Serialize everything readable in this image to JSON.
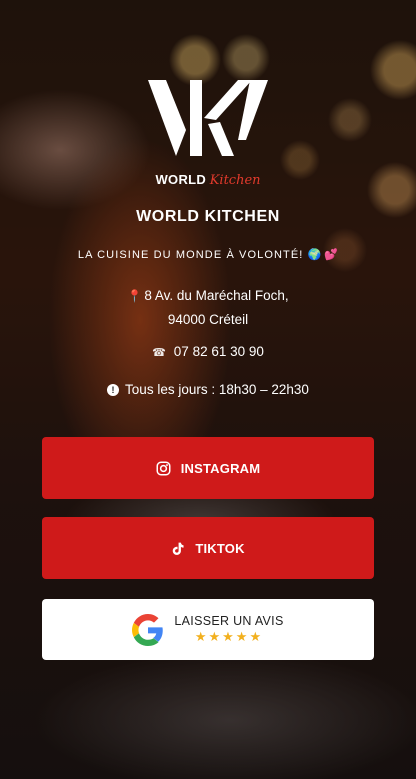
{
  "logo": {
    "brand_word": "WORLD",
    "script_word": "Kitchen"
  },
  "brand_name": "WORLD KITCHEN",
  "tagline": {
    "text": "LA CUISINE DU MONDE À VOLONTÉ!",
    "emojis": "🌍 💕"
  },
  "address": {
    "line1": "8 Av. du Maréchal Foch,",
    "line2": "94000 Créteil"
  },
  "phone": "07 82 61 30 90",
  "hours": "Tous les jours : 18h30 – 22h30",
  "buttons": {
    "instagram": "INSTAGRAM",
    "tiktok": "TIKTOK",
    "review": {
      "label": "LAISSER UN AVIS",
      "stars": "★★★★★",
      "rating": 5
    }
  },
  "colors": {
    "accent": "#cf1a1a",
    "star": "#f2b01e",
    "script": "#e23a2c"
  },
  "icons": [
    "pin-icon",
    "phone-icon",
    "info-icon",
    "instagram-icon",
    "tiktok-icon",
    "google-icon",
    "star-icon"
  ]
}
